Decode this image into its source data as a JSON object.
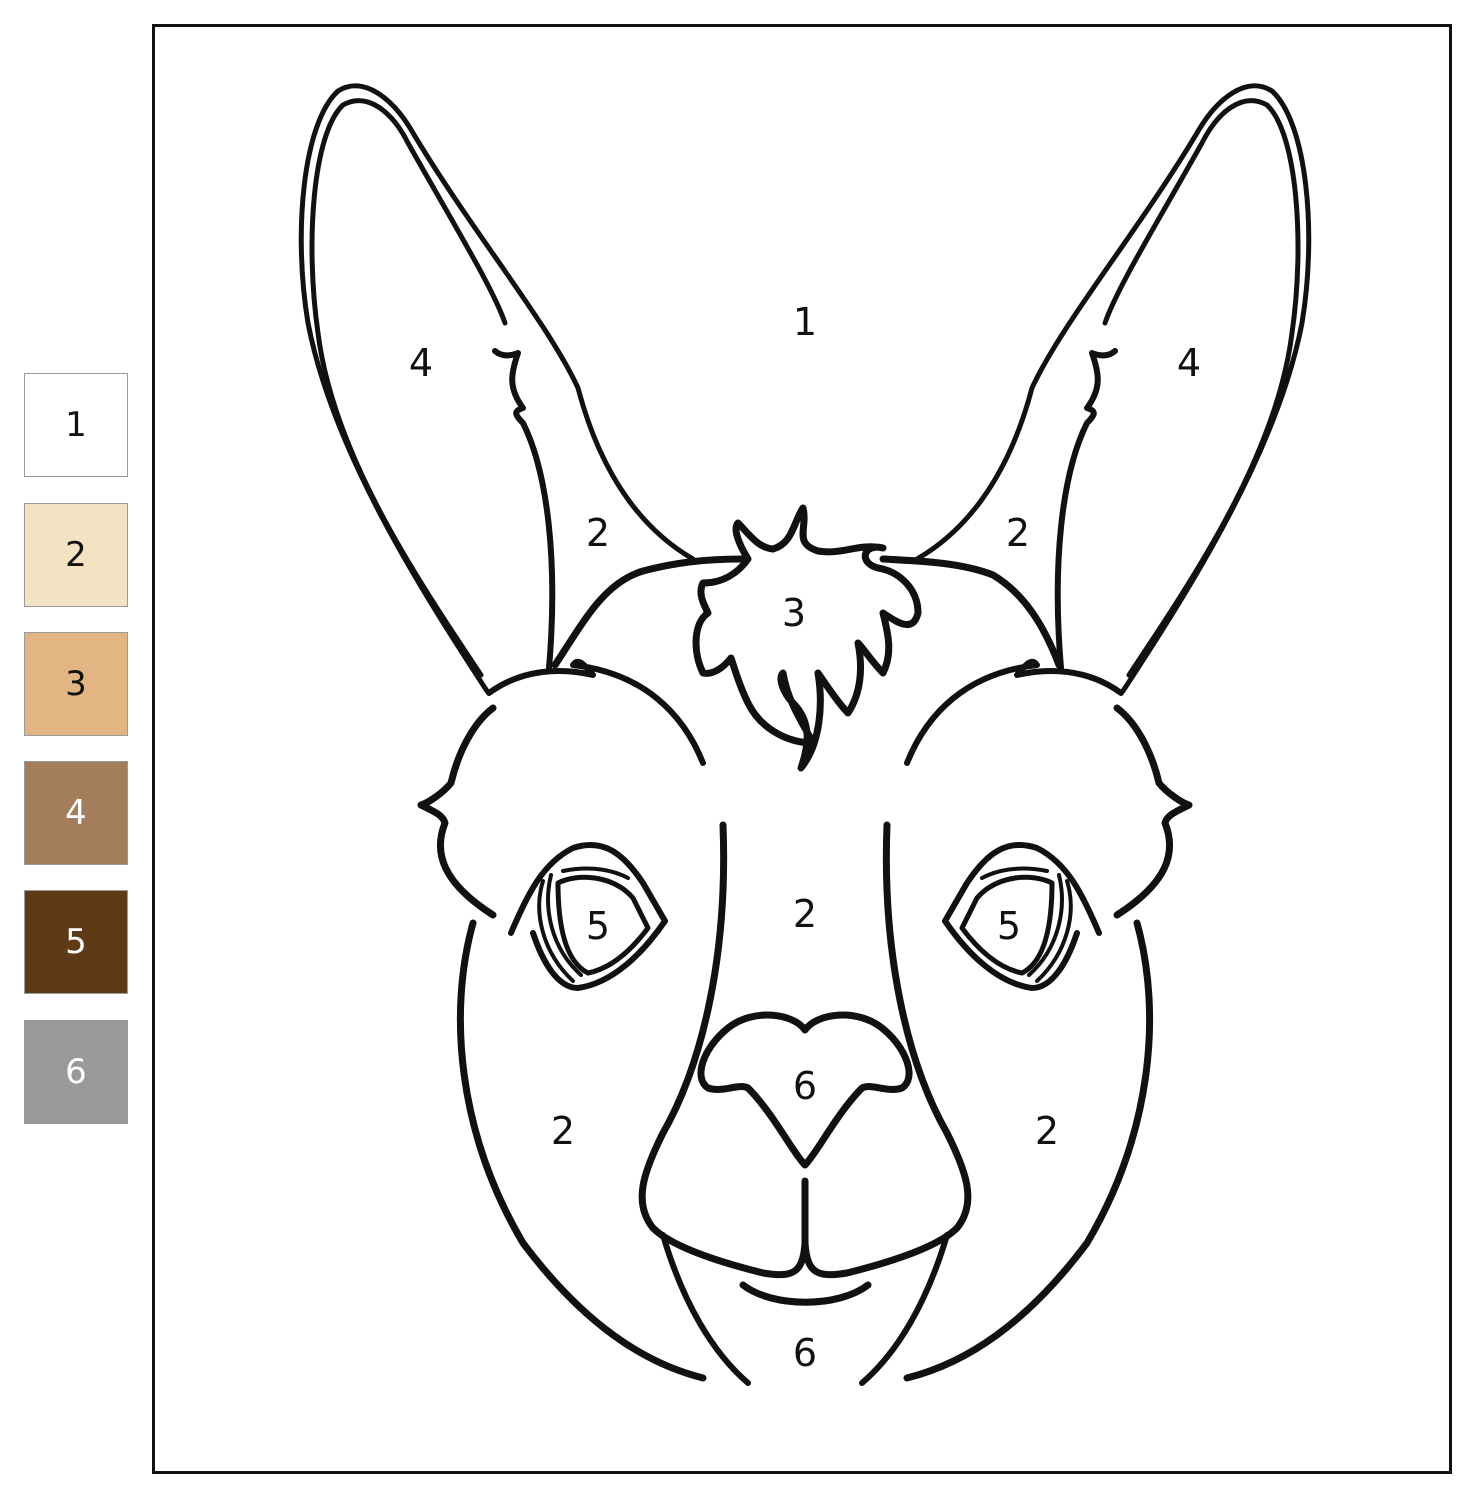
{
  "palette": [
    {
      "number": "1",
      "color": "#ffffff",
      "text_color": "#111111"
    },
    {
      "number": "2",
      "color": "#f3e3c3",
      "text_color": "#111111"
    },
    {
      "number": "3",
      "color": "#e2b582",
      "text_color": "#111111"
    },
    {
      "number": "4",
      "color": "#a47e5c",
      "text_color": "#ffffff"
    },
    {
      "number": "5",
      "color": "#5e3a17",
      "text_color": "#ffffff"
    },
    {
      "number": "6",
      "color": "#999999",
      "text_color": "#ffffff"
    }
  ],
  "regions": {
    "background": "1",
    "ear_inner_left": "4",
    "ear_inner_right": "4",
    "ear_base_left": "2",
    "ear_base_right": "2",
    "forelock": "3",
    "eye_left": "5",
    "eye_right": "5",
    "face_center": "2",
    "nose": "6",
    "cheek_left": "2",
    "cheek_right": "2",
    "chin": "6"
  },
  "icons": {
    "subject": "llama-head-outline"
  }
}
